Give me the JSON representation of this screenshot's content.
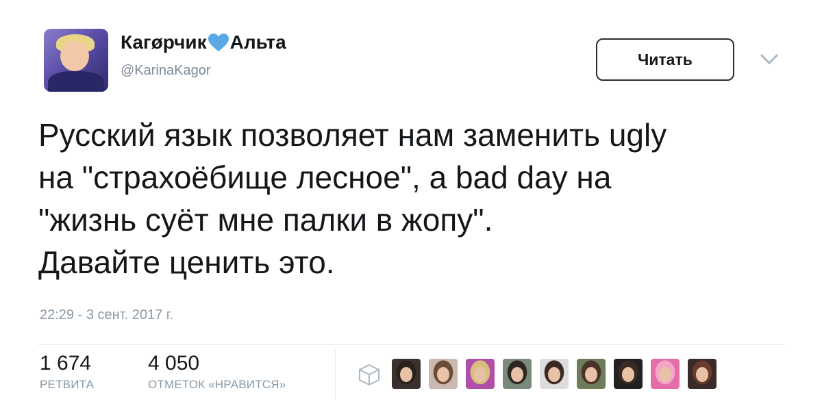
{
  "user": {
    "name_part1": "Кагøрчик",
    "name_part2": "Альта",
    "heart_color": "#5aa9e6",
    "handle": "@KarinaKagor",
    "avatar_icon": "profile-photo"
  },
  "follow_button_label": "Читать",
  "tweet": {
    "lines": [
      "Русский язык позволяет нам заменить ugly",
      "на \"страхоёбище лесное\", а bad day на",
      "\"жизнь суёт мне палки в жопу\".",
      "Давайте ценить это."
    ],
    "timestamp": "22:29 - 3 сент. 2017 г."
  },
  "stats": {
    "retweets": {
      "count": "1 674",
      "label": "РЕТВИТА"
    },
    "likes": {
      "count": "4 050",
      "label": "ОТМЕТОК «НРАВИТСЯ»"
    }
  },
  "likers": [
    {
      "bg": "#3a3030",
      "hair": "#2a211c"
    },
    {
      "bg": "#c9b9b0",
      "hair": "#6b4a36"
    },
    {
      "bg": "#b04fa8",
      "hair": "#d9c07a"
    },
    {
      "bg": "#7a8a7a",
      "hair": "#2e2622"
    },
    {
      "bg": "#dcdcdc",
      "hair": "#3b2a22"
    },
    {
      "bg": "#6d7d5a",
      "hair": "#4a3326"
    },
    {
      "bg": "#222222",
      "hair": "#3a2a24"
    },
    {
      "bg": "#e46fa8",
      "hair": "#f3a6c8"
    },
    {
      "bg": "#3a2a2a",
      "hair": "#6a3a2a"
    }
  ]
}
